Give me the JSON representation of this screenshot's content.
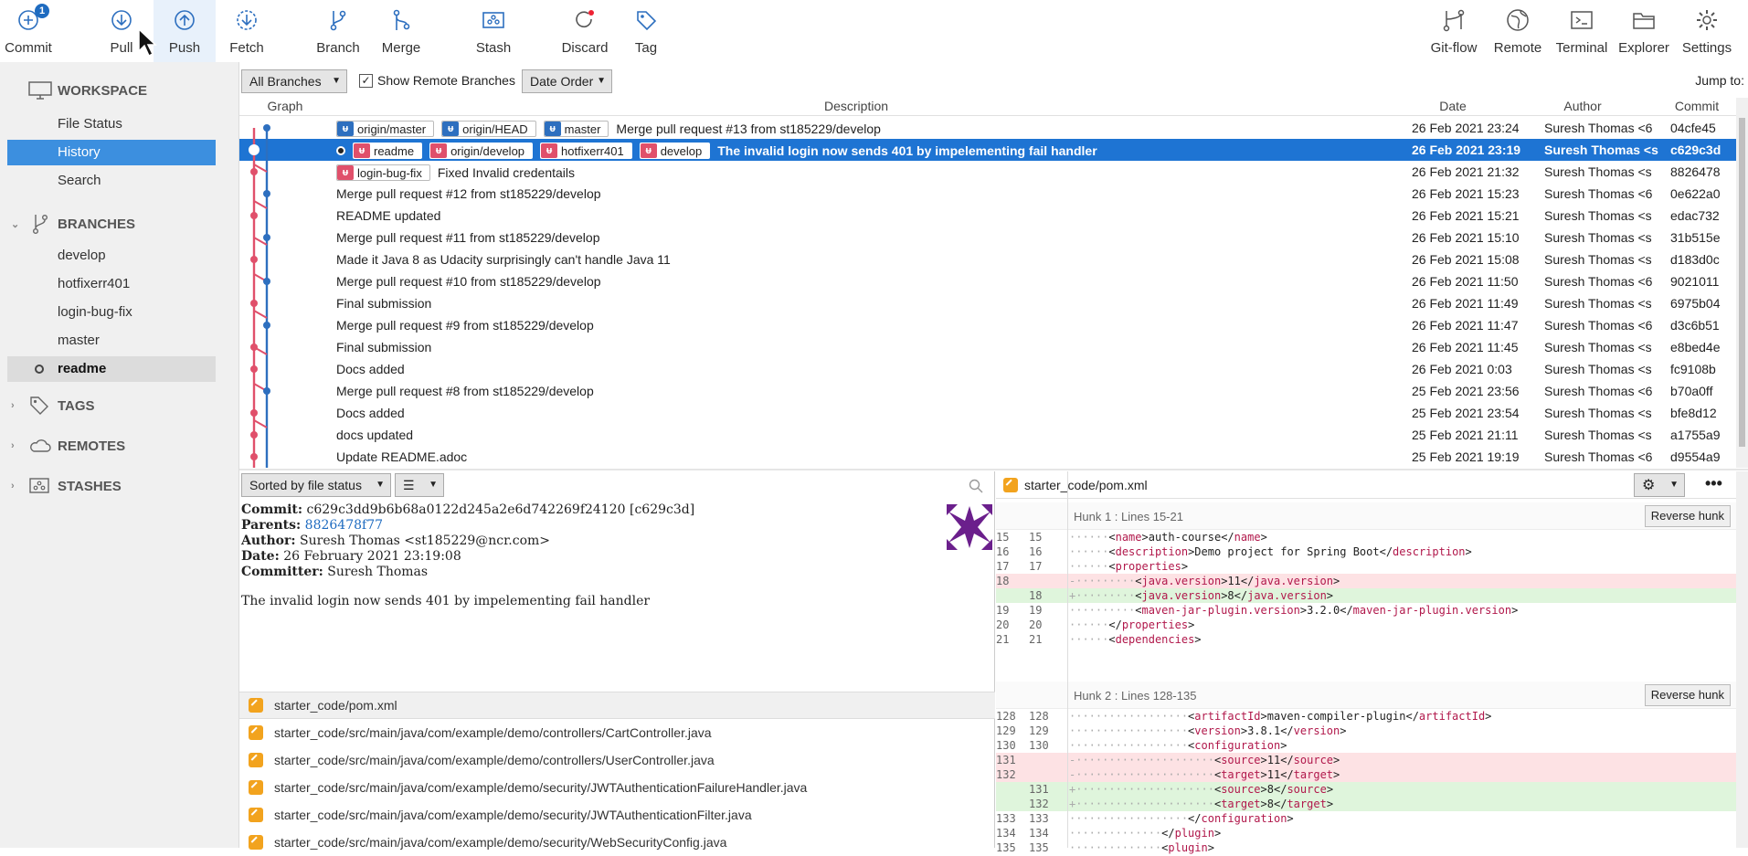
{
  "toolbar": {
    "commit": {
      "label": "Commit",
      "badge": "1"
    },
    "pull": "Pull",
    "push": "Push",
    "fetch": "Fetch",
    "branch": "Branch",
    "merge": "Merge",
    "stash": "Stash",
    "discard": "Discard",
    "tag": "Tag",
    "gitflow": "Git-flow",
    "remote": "Remote",
    "terminal": "Terminal",
    "explorer": "Explorer",
    "settings": "Settings"
  },
  "sidebar": {
    "workspace": "WORKSPACE",
    "workspace_items": [
      "File Status",
      "History",
      "Search"
    ],
    "branches": "BRANCHES",
    "branch_items": [
      "develop",
      "hotfixerr401",
      "login-bug-fix",
      "master",
      "readme"
    ],
    "tags": "TAGS",
    "remotes": "REMOTES",
    "stashes": "STASHES"
  },
  "filters": {
    "all_branches": "All Branches",
    "show_remote": "Show Remote Branches",
    "order": "Date Order",
    "jump_to": "Jump to:"
  },
  "columns": {
    "graph": "Graph",
    "description": "Description",
    "date": "Date",
    "author": "Author",
    "commit": "Commit"
  },
  "commits": [
    {
      "tags": [
        {
          "t": "origin/master",
          "c": "b"
        },
        {
          "t": "origin/HEAD",
          "c": "b"
        },
        {
          "t": "master",
          "c": "b"
        }
      ],
      "msg": "Merge pull request #13 from st185229/develop",
      "date": "26 Feb 2021 23:24",
      "author": "Suresh Thomas <6",
      "hash": "04cfe45"
    },
    {
      "tags": [
        {
          "t": "readme",
          "c": "r"
        },
        {
          "t": "origin/develop",
          "c": "r"
        },
        {
          "t": "hotfixerr401",
          "c": "r"
        },
        {
          "t": "develop",
          "c": "r"
        }
      ],
      "msg": "The invalid login now sends 401 by impelementing fail handler",
      "date": "26 Feb 2021 23:19",
      "author": "Suresh Thomas <s",
      "hash": "c629c3d"
    },
    {
      "tags": [
        {
          "t": "login-bug-fix",
          "c": "r"
        }
      ],
      "msg": "Fixed Invalid credentails",
      "date": "26 Feb 2021 21:32",
      "author": "Suresh Thomas <s",
      "hash": "8826478"
    },
    {
      "tags": [],
      "msg": "Merge pull request #12 from st185229/develop",
      "date": "26 Feb 2021 15:23",
      "author": "Suresh Thomas <6",
      "hash": "0e622a0"
    },
    {
      "tags": [],
      "msg": "README updated",
      "date": "26 Feb 2021 15:21",
      "author": "Suresh Thomas <s",
      "hash": "edac732"
    },
    {
      "tags": [],
      "msg": "Merge pull request #11 from st185229/develop",
      "date": "26 Feb 2021 15:10",
      "author": "Suresh Thomas <s",
      "hash": "31b515e"
    },
    {
      "tags": [],
      "msg": "Made it Java 8 as Udacity surprisingly can't handle Java 11",
      "date": "26 Feb 2021 15:08",
      "author": "Suresh Thomas <s",
      "hash": "d183d0c"
    },
    {
      "tags": [],
      "msg": "Merge pull request #10 from st185229/develop",
      "date": "26 Feb 2021 11:50",
      "author": "Suresh Thomas <6",
      "hash": "9021011"
    },
    {
      "tags": [],
      "msg": "Final submission",
      "date": "26 Feb 2021 11:49",
      "author": "Suresh Thomas <s",
      "hash": "6975b04"
    },
    {
      "tags": [],
      "msg": "Merge pull request #9 from st185229/develop",
      "date": "26 Feb 2021 11:47",
      "author": "Suresh Thomas <6",
      "hash": "d3c6b51"
    },
    {
      "tags": [],
      "msg": "Final submission",
      "date": "26 Feb 2021 11:45",
      "author": "Suresh Thomas <s",
      "hash": "e8bed4e"
    },
    {
      "tags": [],
      "msg": "Docs added",
      "date": "26 Feb 2021 0:03",
      "author": "Suresh Thomas <s",
      "hash": "fc9108b"
    },
    {
      "tags": [],
      "msg": "Merge pull request #8 from st185229/develop",
      "date": "25 Feb 2021 23:56",
      "author": "Suresh Thomas <6",
      "hash": "b70a0ff"
    },
    {
      "tags": [],
      "msg": "Docs added",
      "date": "25 Feb 2021 23:54",
      "author": "Suresh Thomas <s",
      "hash": "bfe8d12"
    },
    {
      "tags": [],
      "msg": "docs updated",
      "date": "25 Feb 2021 21:11",
      "author": "Suresh Thomas <s",
      "hash": "a1755a9"
    },
    {
      "tags": [],
      "msg": "Update README.adoc",
      "date": "25 Feb 2021 19:19",
      "author": "Suresh Thomas <6",
      "hash": "d9554a9"
    }
  ],
  "details": {
    "sort": "Sorted by file status",
    "commit_label": "Commit:",
    "commit_value": "c629c3dd9b6b68a0122d245a2e6d742269f24120 [c629c3d]",
    "parents_label": "Parents:",
    "parents_value": "8826478f77",
    "author_label": "Author:",
    "author_value": "Suresh Thomas <st185229@ncr.com>",
    "date_label": "Date:",
    "date_value": "26 February 2021 23:19:08",
    "committer_label": "Committer:",
    "committer_value": "Suresh Thomas",
    "message": "The invalid login now sends 401 by impelementing fail handler"
  },
  "files": [
    "starter_code/pom.xml",
    "starter_code/src/main/java/com/example/demo/controllers/CartController.java",
    "starter_code/src/main/java/com/example/demo/controllers/UserController.java",
    "starter_code/src/main/java/com/example/demo/security/JWTAuthenticationFailureHandler.java",
    "starter_code/src/main/java/com/example/demo/security/JWTAuthenticationFilter.java",
    "starter_code/src/main/java/com/example/demo/security/WebSecurityConfig.java"
  ],
  "diff": {
    "file": "starter_code/pom.xml",
    "reverse": "Reverse hunk",
    "hunk1_title": "Hunk 1 : Lines 15-21",
    "hunk2_title": "Hunk 2 : Lines 128-135",
    "hunk1": [
      {
        "n1": "15",
        "n2": "15",
        "k": "ctx",
        "ind": "······",
        "pre": "<",
        "tag": "name",
        "mid": ">auth-course</",
        "tag2": "name",
        "end": ">"
      },
      {
        "n1": "16",
        "n2": "16",
        "k": "ctx",
        "ind": "······",
        "pre": "<",
        "tag": "description",
        "mid": ">Demo project for Spring Boot</",
        "tag2": "description",
        "end": ">"
      },
      {
        "n1": "17",
        "n2": "17",
        "k": "ctx",
        "ind": "······",
        "pre": "<",
        "tag": "properties",
        "mid": ">",
        "tag2": "",
        "end": ""
      },
      {
        "n1": "18",
        "n2": "",
        "k": "del",
        "ind": "-·········",
        "pre": "<",
        "tag": "java.version",
        "mid": ">11</",
        "tag2": "java.version",
        "end": ">"
      },
      {
        "n1": "",
        "n2": "18",
        "k": "add",
        "ind": "+·········",
        "pre": "<",
        "tag": "java.version",
        "mid": ">8</",
        "tag2": "java.version",
        "end": ">"
      },
      {
        "n1": "19",
        "n2": "19",
        "k": "ctx",
        "ind": "··········",
        "pre": "<",
        "tag": "maven-jar-plugin.version",
        "mid": ">3.2.0</",
        "tag2": "maven-jar-plugin.version",
        "end": ">"
      },
      {
        "n1": "20",
        "n2": "20",
        "k": "ctx",
        "ind": "······",
        "pre": "</",
        "tag": "properties",
        "mid": ">",
        "tag2": "",
        "end": ""
      },
      {
        "n1": "21",
        "n2": "21",
        "k": "ctx",
        "ind": "······",
        "pre": "<",
        "tag": "dependencies",
        "mid": ">",
        "tag2": "",
        "end": ""
      }
    ],
    "hunk2": [
      {
        "n1": "128",
        "n2": "128",
        "k": "ctx",
        "ind": "··················",
        "pre": "<",
        "tag": "artifactId",
        "mid": ">maven-compiler-plugin</",
        "tag2": "artifactId",
        "end": ">"
      },
      {
        "n1": "129",
        "n2": "129",
        "k": "ctx",
        "ind": "··················",
        "pre": "<",
        "tag": "version",
        "mid": ">3.8.1</",
        "tag2": "version",
        "end": ">"
      },
      {
        "n1": "130",
        "n2": "130",
        "k": "ctx",
        "ind": "··················",
        "pre": "<",
        "tag": "configuration",
        "mid": ">",
        "tag2": "",
        "end": ""
      },
      {
        "n1": "131",
        "n2": "",
        "k": "del",
        "ind": "-·····················",
        "pre": "<",
        "tag": "source",
        "mid": ">11</",
        "tag2": "source",
        "end": ">"
      },
      {
        "n1": "132",
        "n2": "",
        "k": "del",
        "ind": "-·····················",
        "pre": "<",
        "tag": "target",
        "mid": ">11</",
        "tag2": "target",
        "end": ">"
      },
      {
        "n1": "",
        "n2": "131",
        "k": "add",
        "ind": "+·····················",
        "pre": "<",
        "tag": "source",
        "mid": ">8</",
        "tag2": "source",
        "end": ">"
      },
      {
        "n1": "",
        "n2": "132",
        "k": "add",
        "ind": "+·····················",
        "pre": "<",
        "tag": "target",
        "mid": ">8</",
        "tag2": "target",
        "end": ">"
      },
      {
        "n1": "133",
        "n2": "133",
        "k": "ctx",
        "ind": "··················",
        "pre": "</",
        "tag": "configuration",
        "mid": ">",
        "tag2": "",
        "end": ""
      },
      {
        "n1": "134",
        "n2": "134",
        "k": "ctx",
        "ind": "··············",
        "pre": "</",
        "tag": "plugin",
        "mid": ">",
        "tag2": "",
        "end": ""
      },
      {
        "n1": "135",
        "n2": "135",
        "k": "ctx",
        "ind": "··············",
        "pre": "<",
        "tag": "plugin",
        "mid": ">",
        "tag2": "",
        "end": ""
      }
    ]
  },
  "colors": {
    "accent": "#1e74d3",
    "branch_red": "#e0506b",
    "branch_blue": "#2d6fbf"
  }
}
